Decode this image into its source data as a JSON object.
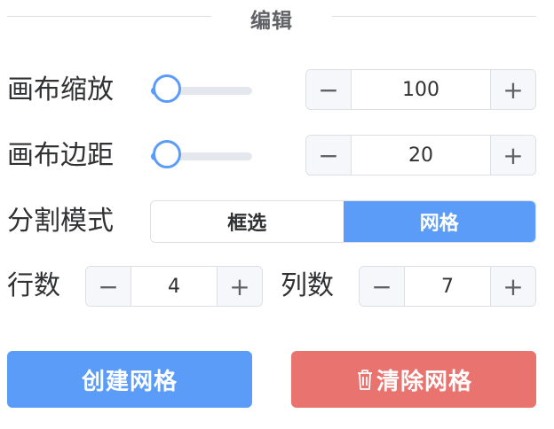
{
  "section": {
    "title": "编辑"
  },
  "canvas_zoom": {
    "label": "画布缩放",
    "value": "100",
    "minus": "−",
    "plus": "+",
    "slider_fraction": 0.02
  },
  "canvas_padding": {
    "label": "画布边距",
    "value": "20",
    "minus": "−",
    "plus": "+",
    "slider_fraction": 0.02
  },
  "split_mode": {
    "label": "分割模式",
    "options": [
      "框选",
      "网格"
    ],
    "selected": "网格"
  },
  "rows": {
    "label": "行数",
    "value": "4",
    "minus": "−",
    "plus": "+"
  },
  "cols": {
    "label": "列数",
    "value": "7",
    "minus": "−",
    "plus": "+"
  },
  "actions": {
    "create": "创建网格",
    "clear": "清除网格"
  },
  "colors": {
    "primary": "#5b9cf8",
    "danger": "#e9736f"
  },
  "icons": {
    "clear": "trash-icon"
  }
}
